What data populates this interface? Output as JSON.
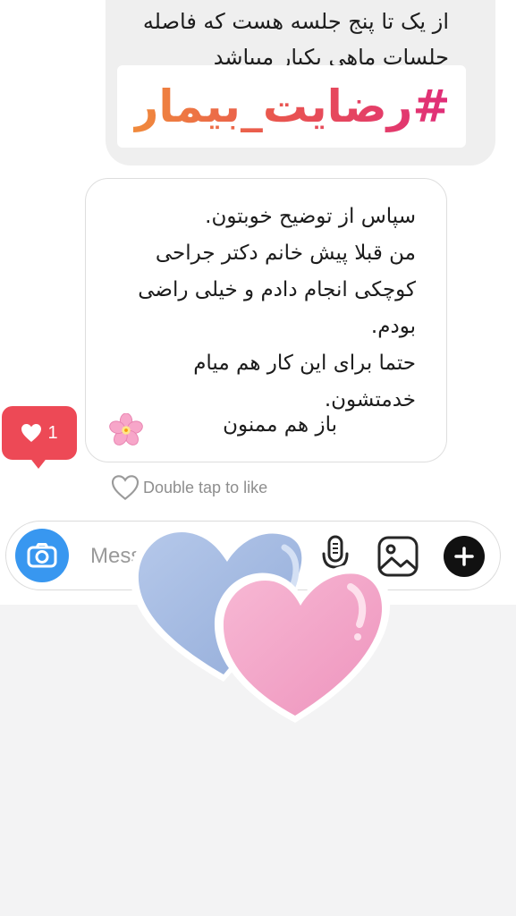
{
  "thread": {
    "received_message": {
      "line1": "از یک تا پنج جلسه هست که فاصله",
      "line2": "جلسات ماهی یکبار میباشد"
    },
    "hashtag_sticker": "#رضایت_بیمار",
    "sent_message": {
      "lines": [
        "سپاس از توضیح خوبتون.",
        "من قبلا پیش خانم دکتر جراحی",
        "کوچکی انجام دادم و خیلی راضی",
        "بودم.",
        "حتما برای این کار هم میام",
        "خدمتشون."
      ],
      "last_line": "باز هم ممنون",
      "emoji": "cherry-blossom"
    },
    "like_badge": {
      "icon": "heart-icon",
      "count": "1"
    },
    "double_tap_hint": "Double tap to like"
  },
  "composer": {
    "placeholder": "Message...",
    "camera_icon": "camera-icon",
    "mic_icon": "microphone-icon",
    "gallery_icon": "gallery-icon",
    "add_icon": "plus-icon"
  },
  "overlay": {
    "sticker": "hearts-sticker"
  },
  "colors": {
    "like_red": "#ed4956",
    "camera_blue": "#3897f0",
    "hashtag_gradient": [
      "#f08a3c",
      "#e9564f",
      "#e02d79"
    ],
    "heart_blue": "#a7bde3",
    "heart_pink": "#f2a7c8"
  }
}
